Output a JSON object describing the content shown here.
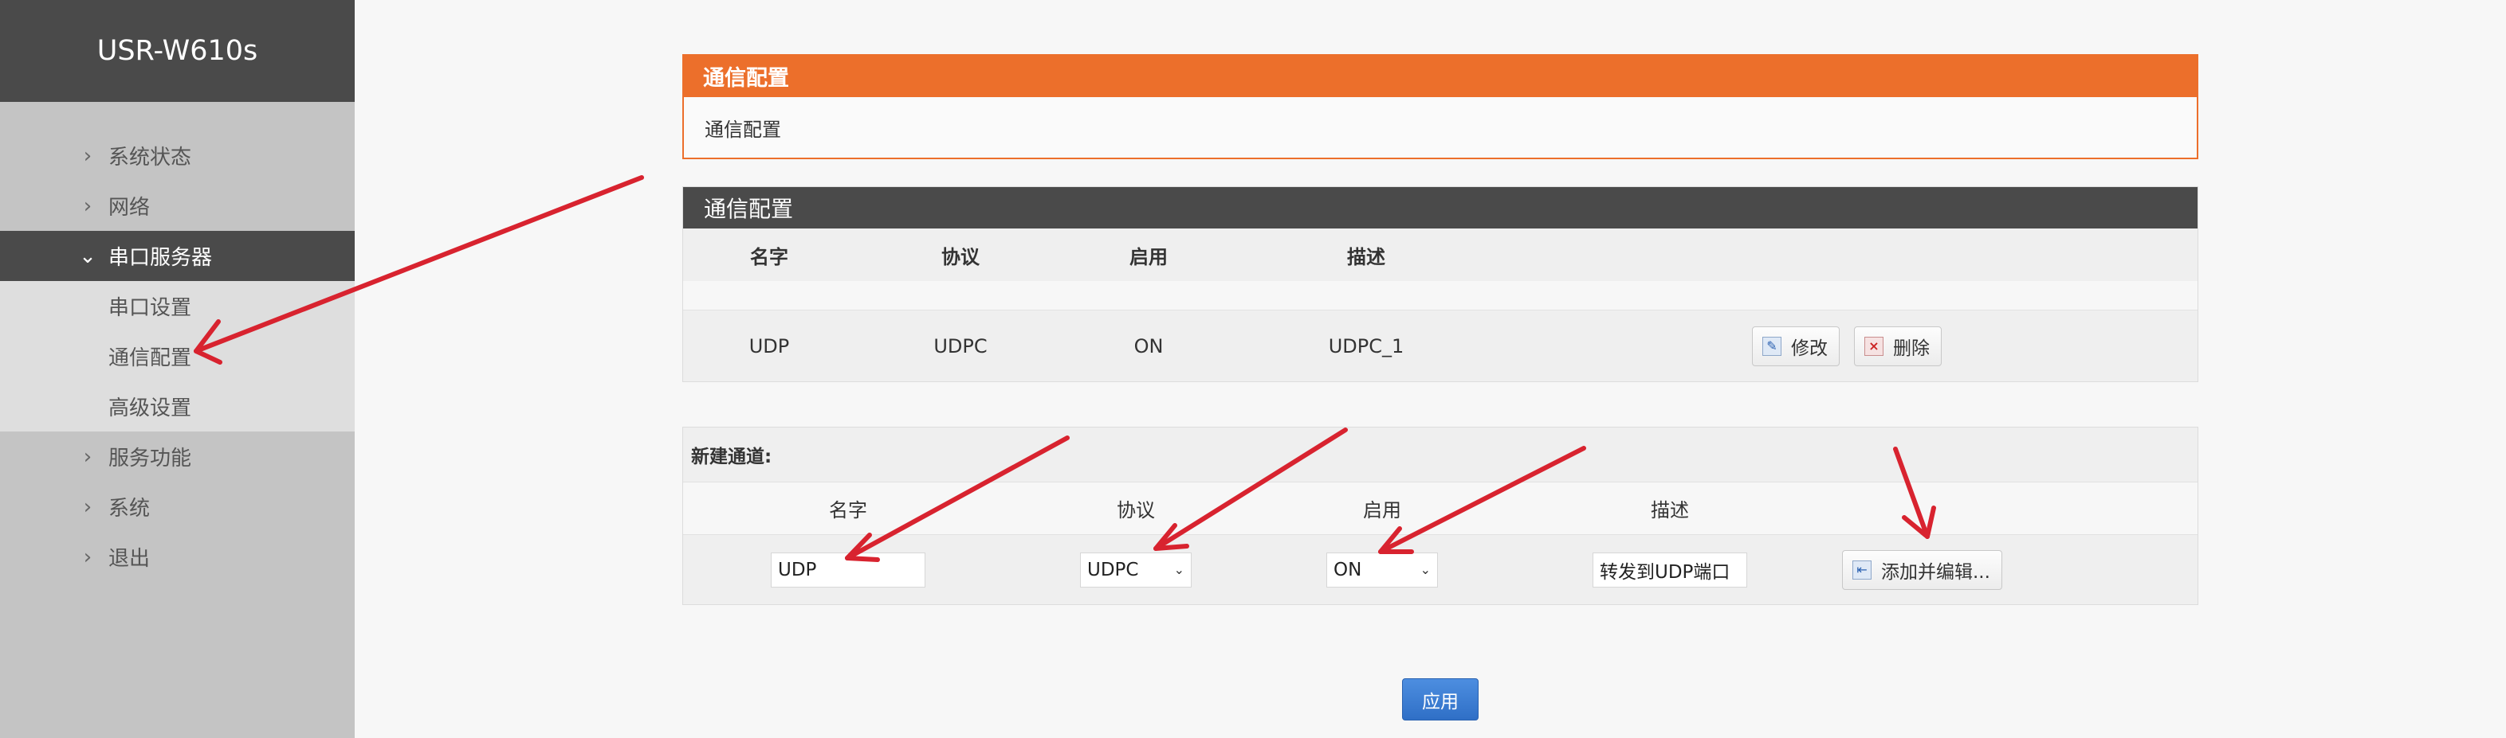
{
  "brand": "USR-W610s",
  "sidebar": {
    "items": [
      {
        "label": "系统状态"
      },
      {
        "label": "网络"
      },
      {
        "label": "串口服务器"
      },
      {
        "label": "串口设置"
      },
      {
        "label": "通信配置"
      },
      {
        "label": "高级设置"
      },
      {
        "label": "服务功能"
      },
      {
        "label": "系统"
      },
      {
        "label": "退出"
      }
    ]
  },
  "panel_top": {
    "header": "通信配置",
    "body": "通信配置"
  },
  "panel_list": {
    "header": "通信配置",
    "columns": [
      "名字",
      "协议",
      "启用",
      "描述"
    ],
    "rows": [
      {
        "name": "UDP",
        "protocol": "UDPC",
        "enabled": "ON",
        "desc": "UDPC_1"
      }
    ],
    "edit_label": "修改",
    "delete_label": "删除"
  },
  "new_channel": {
    "title": "新建通道:",
    "columns": [
      "名字",
      "协议",
      "启用",
      "描述"
    ],
    "name_value": "UDP",
    "protocol_value": "UDPC",
    "enabled_value": "ON",
    "desc_value": "转发到UDP端口",
    "add_label": "添加并编辑..."
  },
  "apply_label": "应用",
  "colors": {
    "accent_orange": "#ec6f2b",
    "header_dark": "#4a4a4a",
    "apply_blue": "#2f6fc6",
    "arrow_red": "#d8232f"
  },
  "icons": [
    "chevron-right-icon",
    "chevron-down-icon",
    "edit-icon",
    "delete-icon",
    "add-icon",
    "dropdown-arrow-icon"
  ]
}
